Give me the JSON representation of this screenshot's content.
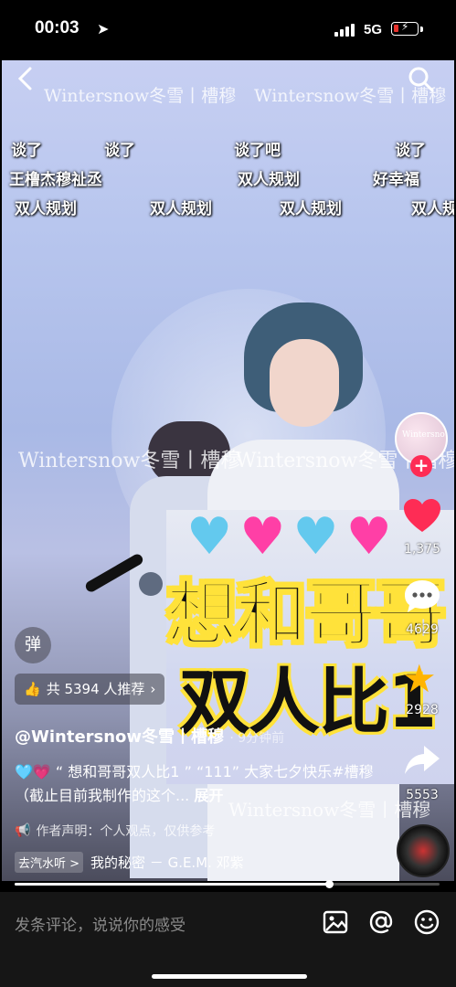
{
  "status_bar": {
    "time": "00:03",
    "network": "5G"
  },
  "watermark": {
    "text": "Wintersnow冬雪",
    "sub": "槽穆"
  },
  "danmu": [
    "谈了",
    "谈了",
    "谈了吧",
    "谈了",
    "王橹杰穆祉丞",
    "双人规划",
    "好幸福",
    "双人规划",
    "双人规划",
    "双人规划",
    "双人规"
  ],
  "sticker": {
    "line1": "想和哥哥",
    "line2": "双人比1"
  },
  "rail": {
    "likes": "1,375",
    "comments": "4629",
    "favorites": "2928",
    "shares": "5553"
  },
  "danmaku_toggle": "弹",
  "recommend": {
    "label": "共 5394 人推荐"
  },
  "author": {
    "handle": "@Wintersnow冬雪丨槽穆",
    "time": "· 9分钟前"
  },
  "caption": {
    "text": "🩵💗 “ 想和哥哥双人比1 ” “111” 大家七夕快乐#槽穆 （截止目前我制作的这个...",
    "more": "展开"
  },
  "statement": "作者声明：个人观点，仅供参考",
  "music": {
    "tag": "去汽水听 >",
    "title": "我的秘密 － G.E.M. 邓紫"
  },
  "progress": 0.74,
  "comment_placeholder": "发条评论，说说你的感受",
  "colors": {
    "like": "#fe2c55",
    "sticker_text_outline": "#ffe23a",
    "accent_star": "#ffb400"
  }
}
